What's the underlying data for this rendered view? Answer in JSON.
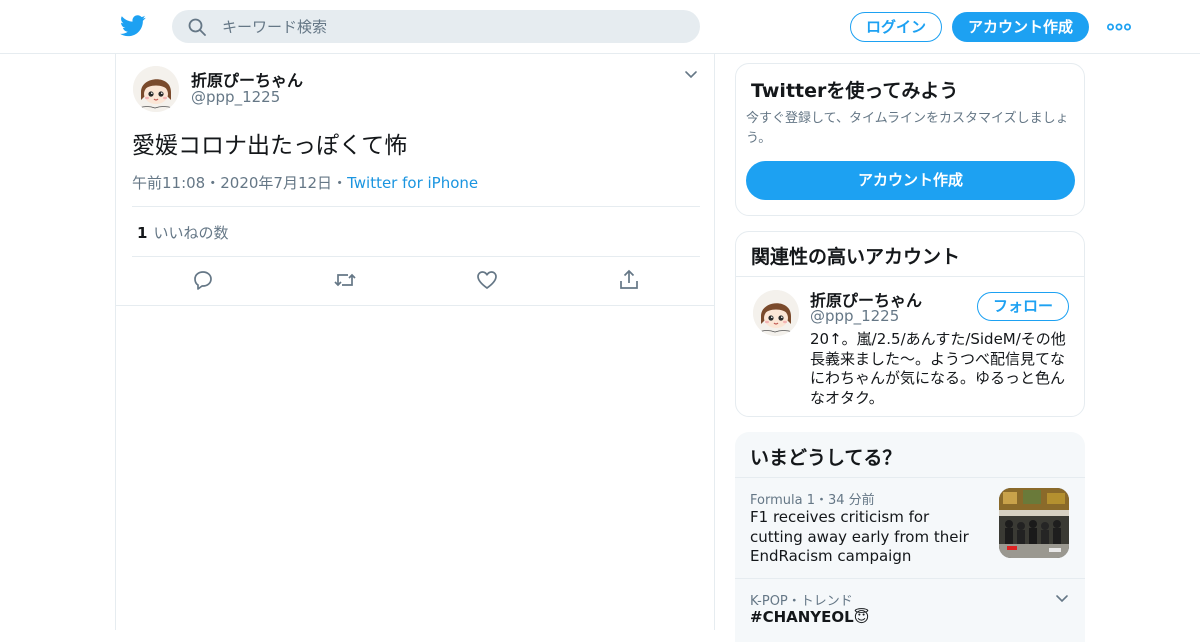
{
  "header": {
    "search_placeholder": "キーワード検索",
    "login_label": "ログイン",
    "signup_label": "アカウント作成"
  },
  "colors": {
    "accent": "#1da1f2",
    "link": "#1b95e0",
    "border": "#e6ecf0",
    "muted": "#657786"
  },
  "tweet": {
    "display_name": "折原ぴーちゃん",
    "handle": "@ppp_1225",
    "text": "愛媛コロナ出たっぽくて怖",
    "time": "午前11:08",
    "date": "2020年7月12日",
    "source": "Twitter for iPhone",
    "like_count": "1",
    "like_label": "いいねの数",
    "action_icons": [
      "reply-icon",
      "retweet-icon",
      "like-icon",
      "share-icon"
    ]
  },
  "sidebar": {
    "try_card": {
      "title": "Twitterを使ってみよう",
      "description": "今すぐ登録して、タイムラインをカスタマイズしましょう。",
      "button_label": "アカウント作成"
    },
    "related_card": {
      "title": "関連性の高いアカウント",
      "account": {
        "display_name": "折原ぴーちゃん",
        "handle": "@ppp_1225",
        "follow_label": "フォロー",
        "bio": "20↑。嵐/2.5/あんすた/SideM/その他 長義来ました〜。ようつべ配信見てなにわちゃんが気になる。ゆるっと色んなオタク。"
      }
    },
    "now_card": {
      "title": "いまどうしてる？",
      "items": [
        {
          "meta": "Formula 1・34 分前",
          "headline": "F1 receives criticism for cutting away early from their EndRacism campaign"
        },
        {
          "meta": "K-POP・トレンド",
          "headline": "#CHANYEOL😇"
        }
      ]
    }
  }
}
